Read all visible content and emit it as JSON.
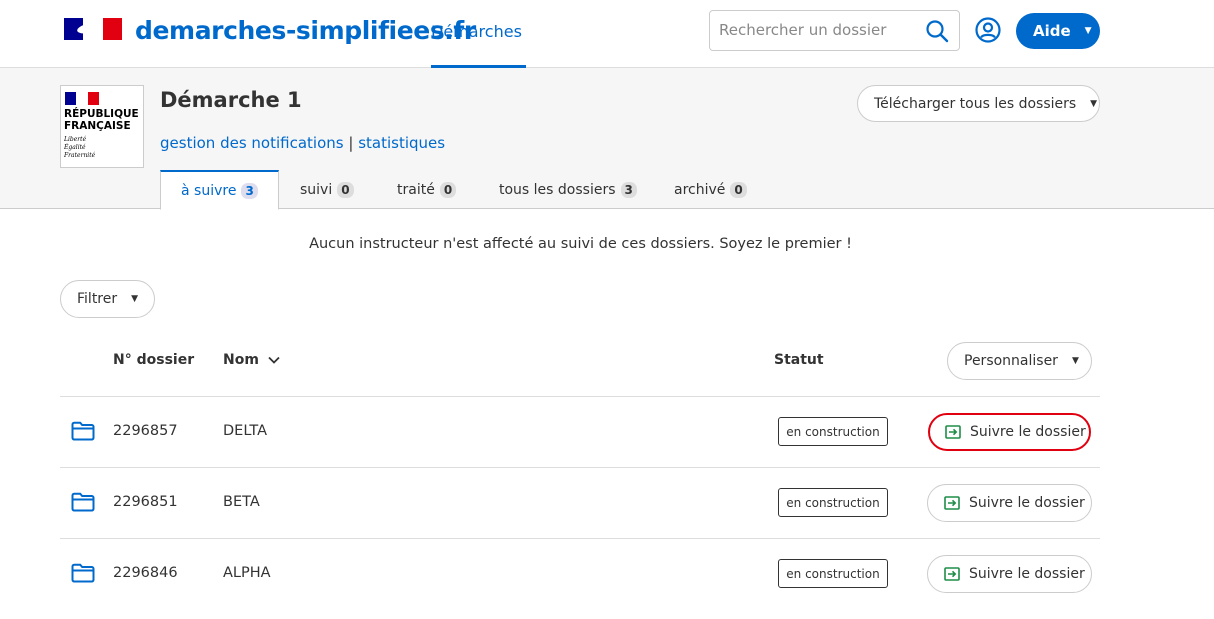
{
  "header": {
    "brand": "demarches-simplifiees.fr",
    "nav_tab": "Démarches",
    "search_placeholder": "Rechercher un dossier",
    "aide_label": "Aide"
  },
  "procedure": {
    "logo_text": "RÉPUBLIQUE\nFRANÇAISE",
    "logo_motto": "Liberté\nÉgalité\nFraternité",
    "title": "Démarche 1",
    "link_notifications": "gestion des notifications",
    "separator": "|",
    "link_stats": "statistiques",
    "download_label": "Télécharger tous les dossiers"
  },
  "tabs": [
    {
      "label": "à suivre",
      "count": "3"
    },
    {
      "label": "suivi",
      "count": "0"
    },
    {
      "label": "traité",
      "count": "0"
    },
    {
      "label": "tous les dossiers",
      "count": "3"
    },
    {
      "label": "archivé",
      "count": "0"
    }
  ],
  "notice": "Aucun instructeur n'est affecté au suivi de ces dossiers. Soyez le premier !",
  "filter_label": "Filtrer",
  "table": {
    "headers": {
      "num": "N° dossier",
      "nom": "Nom",
      "statut": "Statut"
    },
    "customize_label": "Personnaliser",
    "rows": [
      {
        "num": "2296857",
        "nom": "DELTA",
        "status": "en construction",
        "action": "Suivre le dossier"
      },
      {
        "num": "2296851",
        "nom": "BETA",
        "status": "en construction",
        "action": "Suivre le dossier"
      },
      {
        "num": "2296846",
        "nom": "ALPHA",
        "status": "en construction",
        "action": "Suivre le dossier"
      }
    ]
  },
  "colors": {
    "primary": "#0069cc",
    "highlight": "#e1000f",
    "follow_icon": "#1f8d49"
  }
}
